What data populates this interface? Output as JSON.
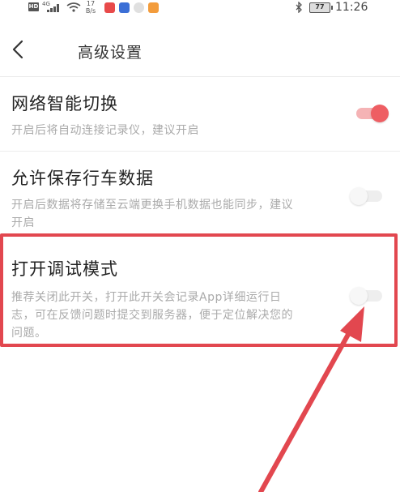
{
  "status_bar": {
    "hd_label": "HD",
    "network_label": "4G",
    "speed_value": "17",
    "speed_unit": "B/s",
    "battery_level": "77",
    "time": "11:26"
  },
  "header": {
    "title": "高级设置"
  },
  "settings": [
    {
      "title": "网络智能切换",
      "description": "开启后将自动连接记录仪，建议开启",
      "enabled": true
    },
    {
      "title": "允许保存行车数据",
      "description": "开启后数据将存储至云端更换手机数据也能同步，建议开启",
      "enabled": false
    },
    {
      "title": "打开调试模式",
      "description": "推荐关闭此开关，打开此开关会记录App详细运行日志，可在反馈问题时提交到服务器，便于定位解决您的问题。",
      "enabled": false
    }
  ],
  "colors": {
    "accent": "#ee5e63",
    "annotation": "#e2474f",
    "text_primary": "#222222",
    "text_secondary": "#aaaaaa"
  }
}
